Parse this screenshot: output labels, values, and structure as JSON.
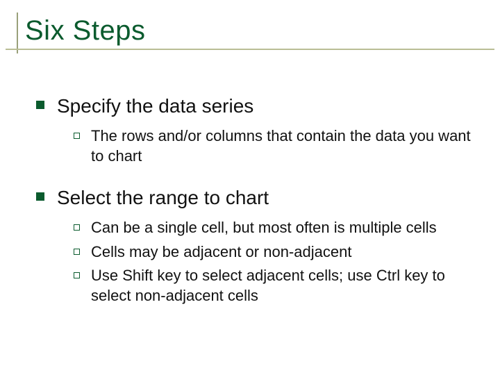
{
  "title": "Six Steps",
  "items": [
    {
      "label": "Specify the data series",
      "sub": [
        "The rows and/or columns that contain the data you want to chart"
      ]
    },
    {
      "label": "Select the range to chart",
      "sub": [
        "Can be a single cell, but most often is multiple cells",
        "Cells may be adjacent or non-adjacent",
        "Use Shift key to select adjacent cells; use Ctrl key to select non-adjacent cells"
      ]
    }
  ]
}
